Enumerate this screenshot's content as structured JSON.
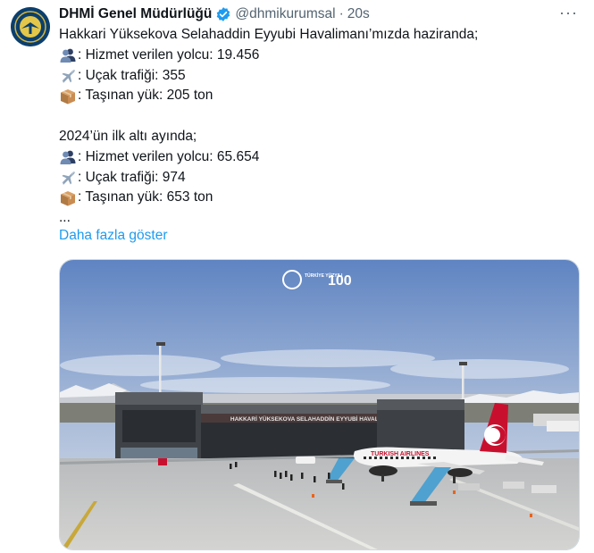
{
  "tweet": {
    "author_name": "DHMİ Genel Müdürlüğü",
    "author_handle": "@dhmikurumsal",
    "separator": "·",
    "time": "20s",
    "more_label": "···",
    "lines": [
      {
        "icon": "",
        "text": "Hakkari Yüksekova Selahaddin Eyyubi Havalimanı’mızda haziranda;"
      },
      {
        "icon": "people-icon",
        "text": ": Hizmet verilen yolcu: 19.456"
      },
      {
        "icon": "airplane-icon",
        "text": ": Uçak trafiği: 355"
      },
      {
        "icon": "package-icon",
        "text": ": Taşınan yük: 205 ton"
      },
      {
        "icon": "",
        "text": ""
      },
      {
        "icon": "",
        "text": "2024’ün ilk altı ayında;"
      },
      {
        "icon": "people-icon",
        "text": ": Hizmet verilen yolcu: 65.654"
      },
      {
        "icon": "airplane-icon",
        "text": ": Uçak trafiği: 974"
      },
      {
        "icon": "package-icon",
        "text": ": Taşınan yük: 653 ton"
      },
      {
        "icon": "",
        "text": "..."
      }
    ],
    "show_more": "Daha fazla göster"
  },
  "media": {
    "overlay_logo_text": "TÜRKİYE YÜZYILI",
    "overlay_100": "100",
    "terminal_sign": "HAKKARİ YÜKSEKOVA SELAHADDİN EYYUBİ HAVALİMANI",
    "airline_livery": "TURKISH AIRLINES"
  },
  "colors": {
    "link": "#1d9bf0",
    "secondary_text": "#536471",
    "verified": "#1d9bf0"
  }
}
